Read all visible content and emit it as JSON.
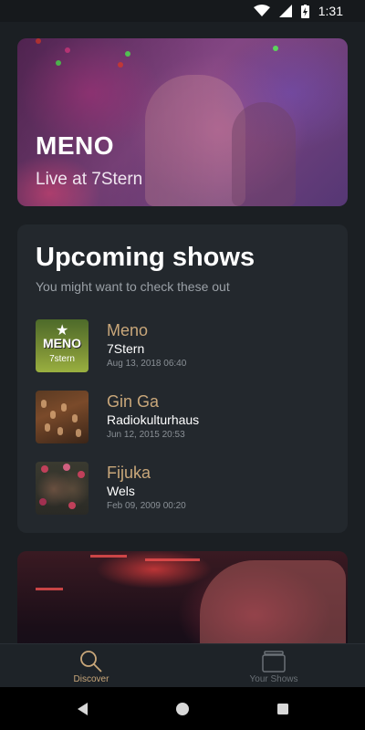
{
  "status_bar": {
    "time": "1:31"
  },
  "hero": {
    "title": "MENO",
    "subtitle": "Live at 7Stern"
  },
  "upcoming": {
    "title": "Upcoming shows",
    "subtitle": "You might want to check these out",
    "shows": [
      {
        "name": "Meno",
        "venue": "7Stern",
        "date": "Aug 13, 2018 06:40",
        "thumb_title": "MENO",
        "thumb_sub": "7stern"
      },
      {
        "name": "Gin Ga",
        "venue": "Radiokulturhaus",
        "date": "Jun 12, 2015 20:53"
      },
      {
        "name": "Fijuka",
        "venue": "Wels",
        "date": "Feb 09, 2009 00:20"
      }
    ]
  },
  "bottom_nav": {
    "items": [
      {
        "label": "Discover",
        "icon": "search-icon"
      },
      {
        "label": "Your Shows",
        "icon": "cards-icon"
      }
    ]
  },
  "colors": {
    "accent": "#c9a77a",
    "background": "#1b1f23",
    "card": "#23282d"
  }
}
